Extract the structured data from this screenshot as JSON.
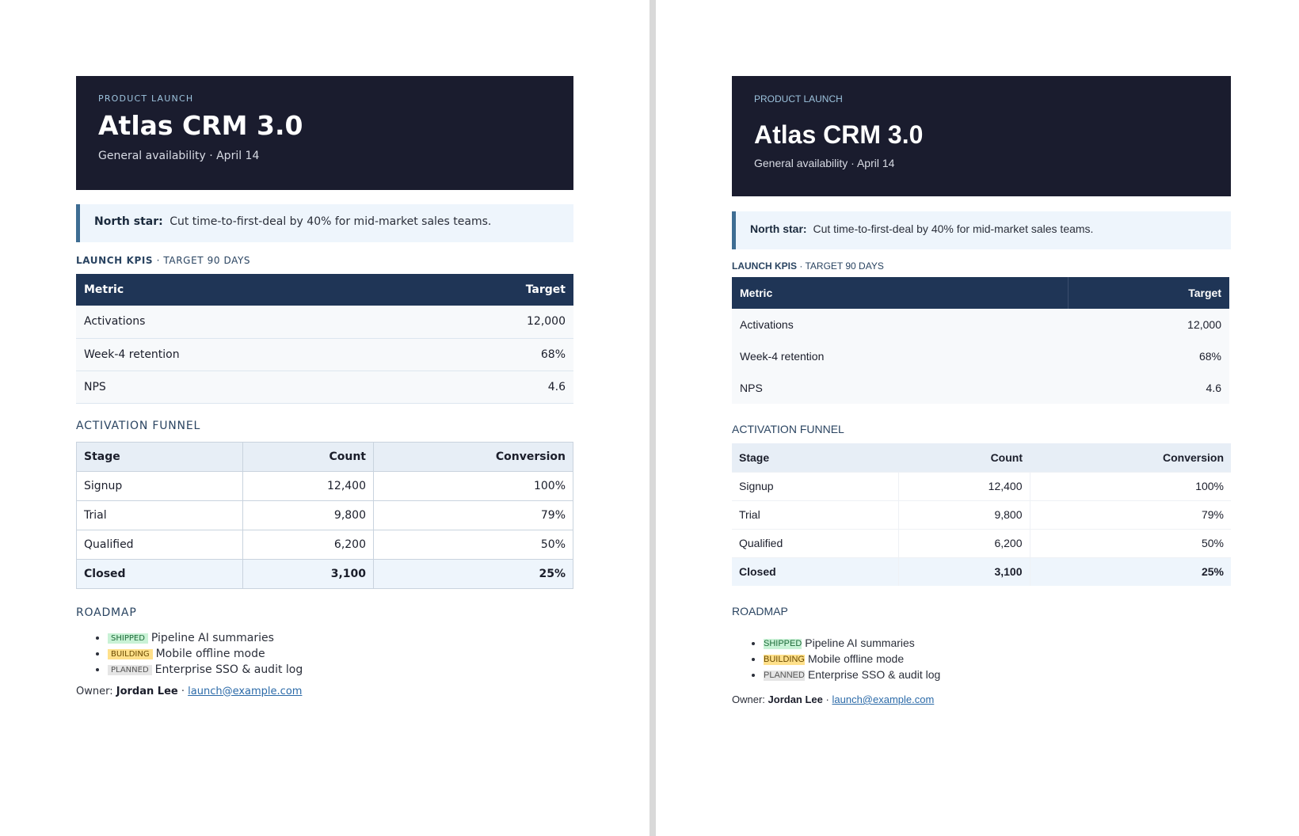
{
  "doc": {
    "eyebrow": "PRODUCT LAUNCH",
    "title": "Atlas CRM 3.0",
    "subtitle": "General availability · April 14",
    "north_star": {
      "label": "North star:",
      "text": "Cut time-to-first-deal by 40% for mid-market sales teams."
    },
    "kpis": {
      "heading_strong": "LAUNCH KPIS",
      "heading_rest": " · TARGET 90 DAYS",
      "columns": [
        "Metric",
        "Target"
      ],
      "rows": [
        [
          "Activations",
          "12,000"
        ],
        [
          "Week-4 retention",
          "68%"
        ],
        [
          "NPS",
          "4.6"
        ]
      ]
    },
    "funnel": {
      "heading": "ACTIVATION FUNNEL",
      "columns": [
        "Stage",
        "Count",
        "Conversion"
      ],
      "rows": [
        [
          "Signup",
          "12,400",
          "100%"
        ],
        [
          "Trial",
          "9,800",
          "79%"
        ],
        [
          "Qualified",
          "6,200",
          "50%"
        ],
        [
          "Closed",
          "3,100",
          "25%"
        ]
      ]
    },
    "roadmap": {
      "heading": "ROADMAP",
      "items": [
        {
          "badge": "SHIPPED",
          "text": "Pipeline AI summaries"
        },
        {
          "badge": "BUILDING",
          "text": "Mobile offline mode"
        },
        {
          "badge": "PLANNED",
          "text": "Enterprise SSO & audit log"
        }
      ]
    },
    "owner": {
      "label": "Owner:",
      "name": "Jordan Lee",
      "separator": "·",
      "email": "launch@example.com"
    }
  },
  "colors": {
    "hero_bg": "#1a1c2e",
    "table_header_bg": "#1f3556",
    "accent_border": "#3e6d93",
    "shipped": "#c9f2d6",
    "building": "#ffe08a",
    "planned": "#e5e5e5"
  }
}
